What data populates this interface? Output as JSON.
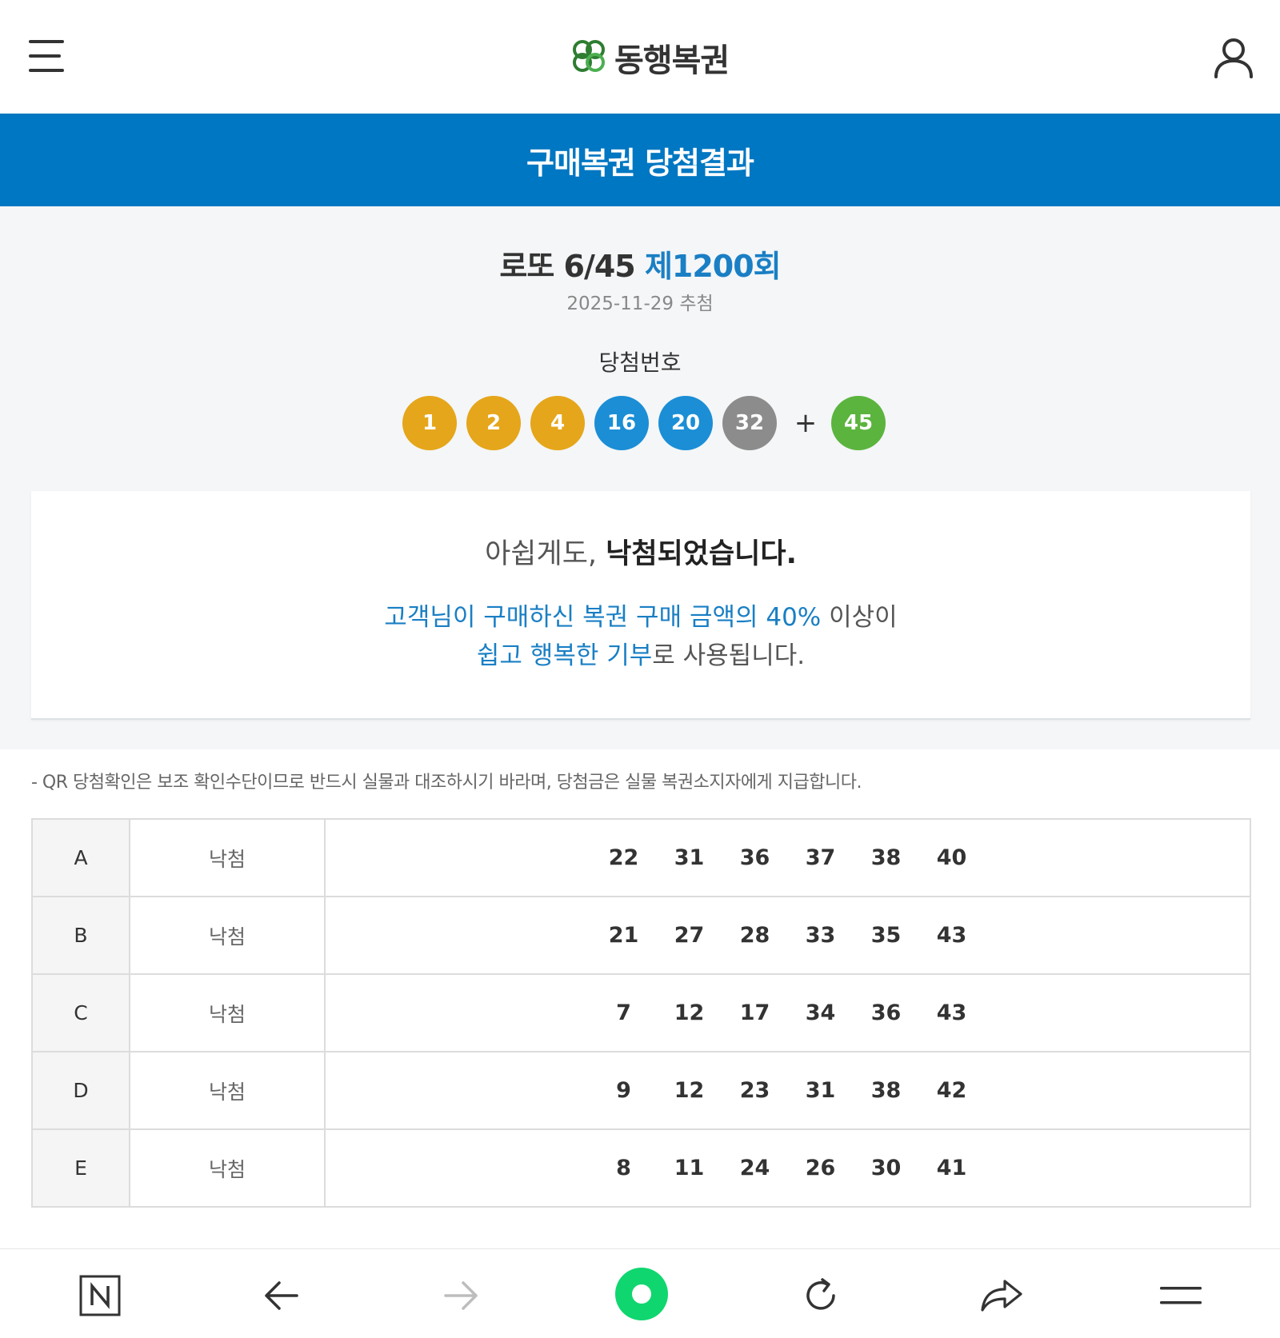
{
  "header": {
    "brand": "동행복권",
    "menu_icon": "hamburger-menu-icon",
    "user_icon": "user-account-icon"
  },
  "page": {
    "title": "구매복권 당첨결과"
  },
  "draw": {
    "game": "로또 6/45",
    "round": "제1200회",
    "date": "2025-11-29 추첨",
    "winning_label": "당첨번호",
    "numbers": [
      {
        "value": "1",
        "color": "#e5a61b"
      },
      {
        "value": "2",
        "color": "#e5a61b"
      },
      {
        "value": "4",
        "color": "#e5a61b"
      },
      {
        "value": "16",
        "color": "#1b8ed6"
      },
      {
        "value": "20",
        "color": "#1b8ed6"
      },
      {
        "value": "32",
        "color": "#8c8c8c"
      }
    ],
    "plus": "+",
    "bonus": {
      "value": "45",
      "color": "#5bb43e"
    }
  },
  "message": {
    "prefix": "아쉽게도, ",
    "result": "낙첨되었습니다.",
    "donation_part1": "고객님이 구매하신 복권 구매 금액의 40%",
    "donation_part2": " 이상이",
    "donation_part3": "쉽고 행복한 기부",
    "donation_part4": "로 사용됩니다."
  },
  "notice": "- QR 당첨확인은 보조 확인수단이므로 반드시 실물과 대조하시기 바라며, 당첨금은 실물 복권소지자에게 지급합니다.",
  "tickets": [
    {
      "game": "A",
      "status": "낙첨",
      "numbers": [
        "22",
        "31",
        "36",
        "37",
        "38",
        "40"
      ]
    },
    {
      "game": "B",
      "status": "낙첨",
      "numbers": [
        "21",
        "27",
        "28",
        "33",
        "35",
        "43"
      ]
    },
    {
      "game": "C",
      "status": "낙첨",
      "numbers": [
        "7",
        "12",
        "17",
        "34",
        "36",
        "43"
      ]
    },
    {
      "game": "D",
      "status": "낙첨",
      "numbers": [
        "9",
        "12",
        "23",
        "31",
        "38",
        "42"
      ]
    },
    {
      "game": "E",
      "status": "낙첨",
      "numbers": [
        "8",
        "11",
        "24",
        "26",
        "30",
        "41"
      ]
    }
  ],
  "bottom_bar": {
    "icons": [
      "naver-home-icon",
      "back-arrow-icon",
      "forward-arrow-icon",
      "green-dot-icon",
      "reload-icon",
      "share-icon",
      "menu-icon"
    ],
    "accent": "#10d66f"
  },
  "colors": {
    "primary": "#0077c2",
    "link_blue": "#1a7fc4"
  }
}
